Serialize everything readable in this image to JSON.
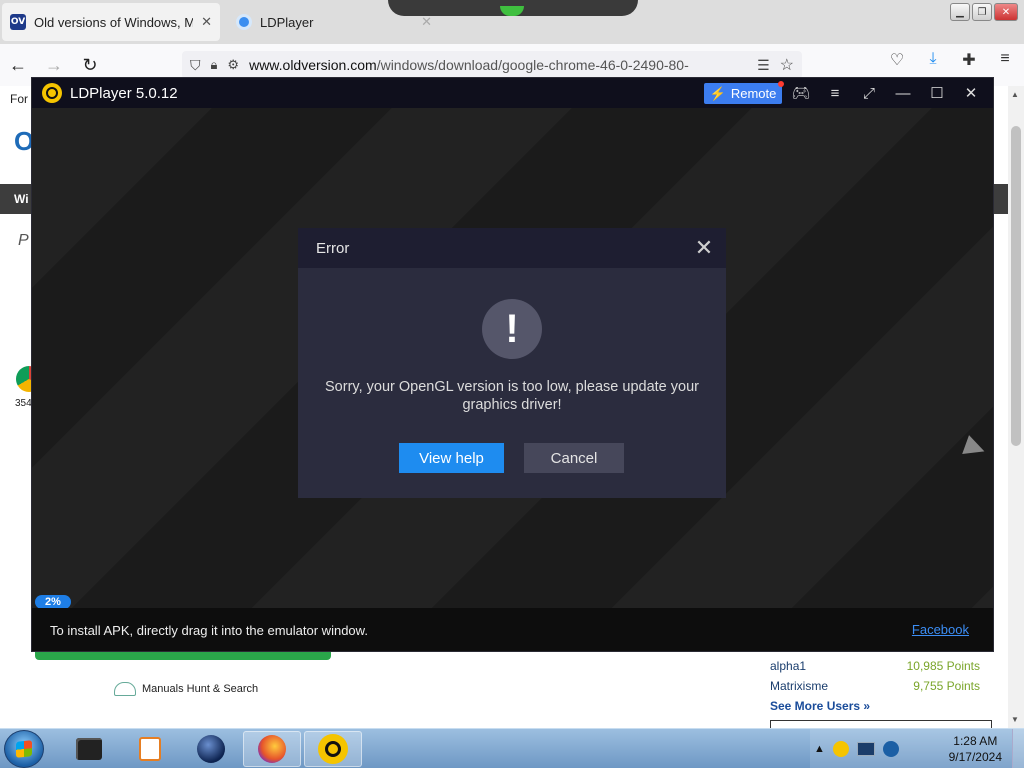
{
  "browser": {
    "tabs": [
      {
        "title": "Old versions of Windows, Mac",
        "favicon": "OV",
        "active": true
      },
      {
        "title": "LDPlayer",
        "active": false
      }
    ],
    "url_prefix": "www.oldversion.com",
    "url_path": "/windows/download/google-chrome-46-0-2490-80-"
  },
  "background_page": {
    "for_label": "For",
    "logo_fragment": "O",
    "nav_fragment": "Wi",
    "heading_fragment": "P",
    "count_fragment": "354",
    "manuals_label": "Manuals Hunt & Search",
    "users": [
      {
        "name": "alpha1",
        "points": "10,985 Points"
      },
      {
        "name": "Matrixisme",
        "points": "9,755 Points"
      }
    ],
    "see_more": "See More Users »"
  },
  "ldplayer": {
    "title": "LDPlayer 5.0.12",
    "remote_label": "Remote",
    "progress": "2%",
    "install_hint": "To install APK, directly drag it into the emulator window.",
    "facebook_link": "Facebook"
  },
  "dialog": {
    "title": "Error",
    "icon": "!",
    "message": "Sorry, your OpenGL version is too low, please update your graphics driver!",
    "help_button": "View help",
    "cancel_button": "Cancel"
  },
  "taskbar": {
    "time": "1:28 AM",
    "date": "9/17/2024"
  },
  "colors": {
    "accent": "#1e8cf0",
    "dialog_bg": "#2b2c3e",
    "dialog_header": "#1e1e31",
    "remote_btn": "#3c7df0"
  }
}
